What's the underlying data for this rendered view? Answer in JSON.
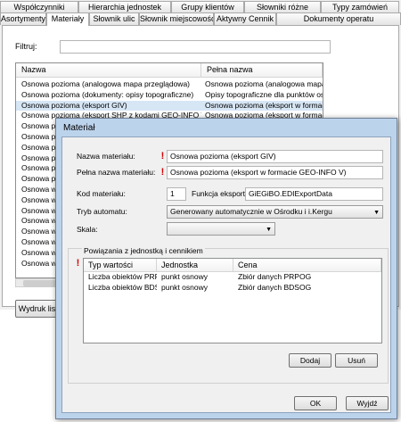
{
  "tabs_row1": [
    "Współczynniki",
    "Hierarchia jednostek",
    "Grupy klientów",
    "Słowniki różne",
    "Typy zamówień"
  ],
  "tabs_row2": [
    "Asortymenty",
    "Materiały",
    "Słownik ulic",
    "Słownik miejscowości",
    "Aktywny Cennik",
    "Dokumenty operatu"
  ],
  "active_tab": "Materiały",
  "filter": {
    "label": "Filtruj:",
    "value": ""
  },
  "list": {
    "columns": [
      "Nazwa",
      "Pełna nazwa"
    ],
    "rows": [
      [
        "Osnowa pozioma (analogowa mapa przeglądowa)",
        "Osnowa pozioma (analogowa mapa p"
      ],
      [
        "Osnowa pozioma (dokumenty: opisy topograficzne)",
        "Opisy topograficzne dla punktów osn."
      ],
      [
        "Osnowa pozioma (eksport GIV)",
        "Osnowa pozioma (eksport w formacie"
      ],
      [
        "Osnowa pozioma (eksport SHP z kodami GEO-INFO V)",
        "Osnowa pozioma (eksport w formacie"
      ],
      [
        "Osnowa pozio",
        ""
      ],
      [
        "Osnowa pozio",
        ""
      ],
      [
        "Osnowa pozio",
        ""
      ],
      [
        "Osnowa pozio",
        ""
      ],
      [
        "Osnowa pozio",
        ""
      ],
      [
        "Osnowa pozio",
        ""
      ],
      [
        "Osnowa wyso",
        ""
      ],
      [
        "Osnowa wyso",
        ""
      ],
      [
        "Osnowa wyso",
        ""
      ],
      [
        "Osnowa wyso",
        ""
      ],
      [
        "Osnowa wyso",
        ""
      ],
      [
        "Osnowa wyso",
        ""
      ],
      [
        "Osnowa wyso",
        ""
      ],
      [
        "Osnowa wyso",
        ""
      ]
    ],
    "selected_index": 2
  },
  "print_button": "Wydruk listy",
  "dialog": {
    "title": "Materiał",
    "nazwa_label": "Nazwa materiału:",
    "nazwa_value": "Osnowa pozioma (eksport GIV)",
    "pelna_label": "Pełna nazwa materiału:",
    "pelna_value": "Osnowa pozioma (eksport w formacie GEO-INFO V)",
    "kod_label": "Kod materiału:",
    "kod_value": "1",
    "funkcja_label": "Funkcja eksportu:",
    "funkcja_value": "GiEGiBO.EDIExportData",
    "tryb_label": "Tryb automatu:",
    "tryb_value": "Generowany automatycznie w Ośrodku i i.Kergu",
    "skala_label": "Skala:",
    "skala_value": "",
    "group_title": "Powiązania z jednostką i cennikiem",
    "table": {
      "columns": [
        "Typ wartości",
        "Jednostka",
        "Cena"
      ],
      "rows": [
        [
          "Liczba obiektów PRP...",
          "punkt osnowy",
          "Zbiór danych PRPOG"
        ],
        [
          "Liczba obiektów BDS...",
          "punkt osnowy",
          "Zbiór danych BDSOG"
        ]
      ]
    },
    "add_button": "Dodaj",
    "delete_button": "Usuń",
    "ok_button": "OK",
    "exit_button": "Wyjdź"
  }
}
